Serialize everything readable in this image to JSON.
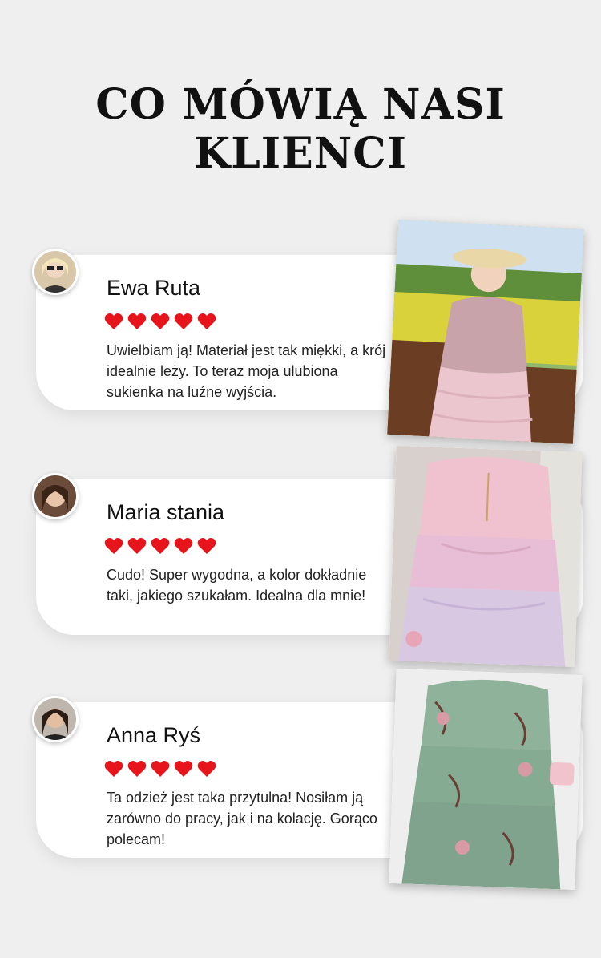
{
  "page": {
    "title": "CO MÓWIĄ NASI KLIENCI"
  },
  "reviews": [
    {
      "name": "Ewa Ruta",
      "rating": 5,
      "text": "Uwielbiam ją! Materiał jest tak miękki, a krój idealnie leży. To teraz moja ulubiona sukienka na luźne wyjścia."
    },
    {
      "name": "Maria stania",
      "rating": 5,
      "text": "Cudo! Super wygodna, a kolor dokładnie taki, jakiego szukałam. Idealna dla mnie!"
    },
    {
      "name": "Anna Ryś",
      "rating": 5,
      "text": "Ta odzież jest taka przytulna! Nosiłam ją zarówno do pracy, jak i na kolację. Gorąco polecam!"
    }
  ],
  "colors": {
    "heart": "#e8141b",
    "background": "#efefef",
    "card": "#ffffff"
  }
}
